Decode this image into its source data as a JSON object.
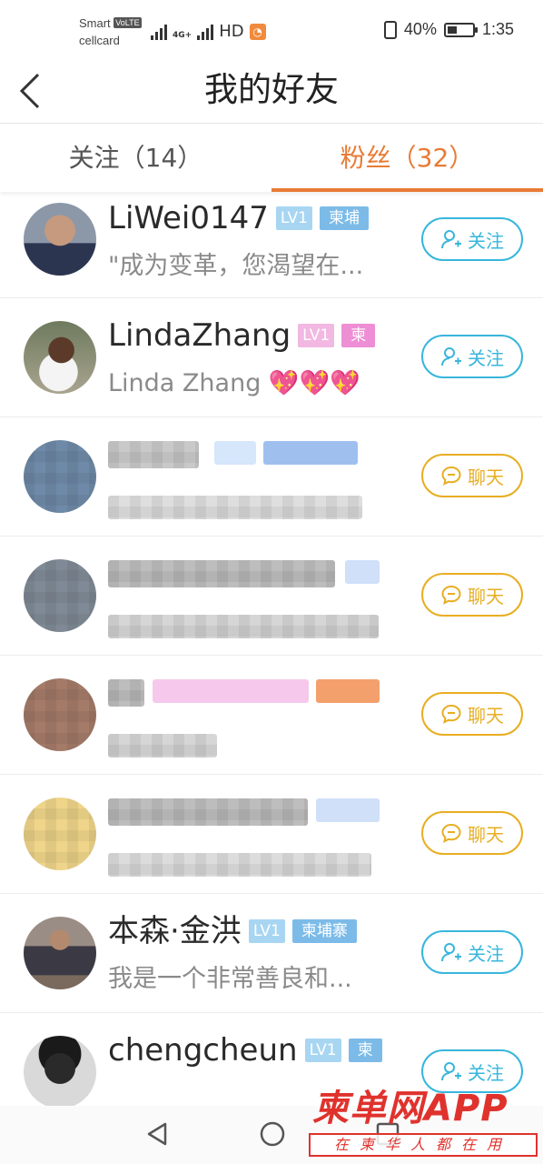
{
  "status_bar": {
    "carrier_name": "Smart",
    "carrier_badge": "VoLTE",
    "carrier_sub": "cellcard",
    "network_type": "4G+",
    "hd_label": "HD",
    "battery_text": "40%",
    "battery_level": 0.4,
    "time": "1:35"
  },
  "header": {
    "title": "我的好友"
  },
  "tabs": [
    {
      "label": "关注（14）",
      "active": false
    },
    {
      "label": "粉丝（32）",
      "active": true
    }
  ],
  "colors": {
    "accent": "#e87b35",
    "follow_blue": "#38b6dc",
    "chat_gold": "#e8ae22",
    "lv_badge": "#a8d6f2",
    "loc_badge": "#7cbbe8",
    "pink_badge": "#f2b8e2",
    "watermark_red": "#e0322d"
  },
  "friends": [
    {
      "name": "LiWei0147",
      "level": "LV1",
      "location": "柬埔",
      "bio": "\"成为变革，您渴望在...",
      "action": "关注",
      "action_type": "follow",
      "badge_style": "blue"
    },
    {
      "name": "LindaZhang",
      "level": "LV1",
      "location": "柬",
      "bio": "Linda Zhang",
      "bio_emoji": "💖💖💖",
      "action": "关注",
      "action_type": "follow",
      "badge_style": "pink"
    },
    {
      "name": "",
      "level": "",
      "location": "",
      "bio": "",
      "action": "聊天",
      "action_type": "chat",
      "blurred": true
    },
    {
      "name": "",
      "level": "",
      "location": "",
      "bio": "",
      "action": "聊天",
      "action_type": "chat",
      "blurred": true
    },
    {
      "name": "",
      "level": "",
      "location": "",
      "bio": "",
      "action": "聊天",
      "action_type": "chat",
      "blurred": true
    },
    {
      "name": "",
      "level": "",
      "location": "",
      "bio": "",
      "action": "聊天",
      "action_type": "chat",
      "blurred": true
    },
    {
      "name": "本森·金洪",
      "level": "LV1",
      "location": "柬埔寨",
      "bio": "我是一个非常善良和...",
      "action": "关注",
      "action_type": "follow",
      "badge_style": "blue"
    },
    {
      "name": "chengcheun",
      "level": "LV1",
      "location": "柬",
      "bio": "",
      "action": "关注",
      "action_type": "follow",
      "badge_style": "blue"
    }
  ],
  "nav_bar": {
    "back_icon": "triangle-back-icon",
    "home_icon": "circle-home-icon",
    "recent_icon": "square-recent-icon"
  },
  "watermark": {
    "brand": "柬单网APP",
    "slogan": "在柬华人都在用"
  }
}
